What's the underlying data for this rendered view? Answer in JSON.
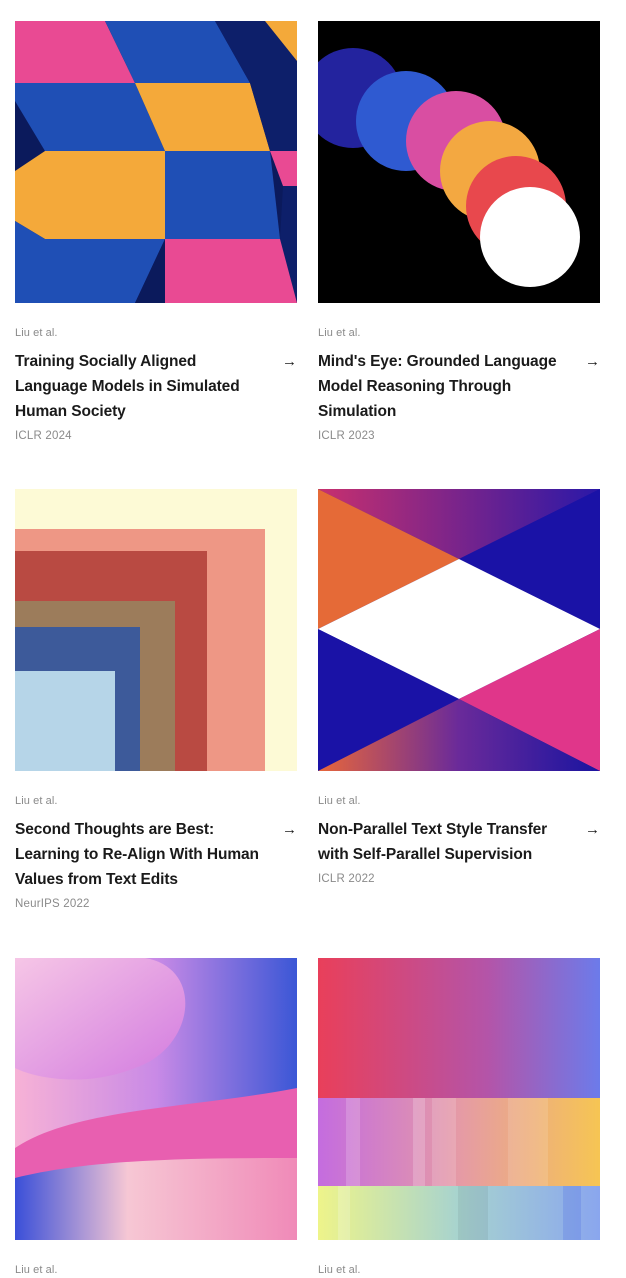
{
  "papers": [
    {
      "author": "Liu et al.",
      "title": "Training Socially Aligned Language Models in Simulated Human Society",
      "venue": "ICLR 2024",
      "arrow": "→",
      "art": "cubes-art"
    },
    {
      "author": "Liu et al.",
      "title": "Mind's Eye: Grounded Language Model Reasoning Through Simulation",
      "venue": "ICLR 2023",
      "arrow": "→",
      "art": "circles-art"
    },
    {
      "author": "Liu et al.",
      "title": "Second Thoughts are Best: Learning to Re-Align With Human Values from Text Edits",
      "venue": "NeurIPS 2022",
      "arrow": "→",
      "art": "nested-squares-art"
    },
    {
      "author": "Liu et al.",
      "title": "Non-Parallel Text Style Transfer with Self-Parallel Supervision",
      "venue": "ICLR 2022",
      "arrow": "→",
      "art": "triangles-art"
    },
    {
      "author": "Liu et al.",
      "title": "",
      "venue": "",
      "arrow": "",
      "art": "gradient-waves-art"
    },
    {
      "author": "Liu et al.",
      "title": "",
      "venue": "",
      "arrow": "",
      "art": "gradient-bands-art"
    }
  ]
}
